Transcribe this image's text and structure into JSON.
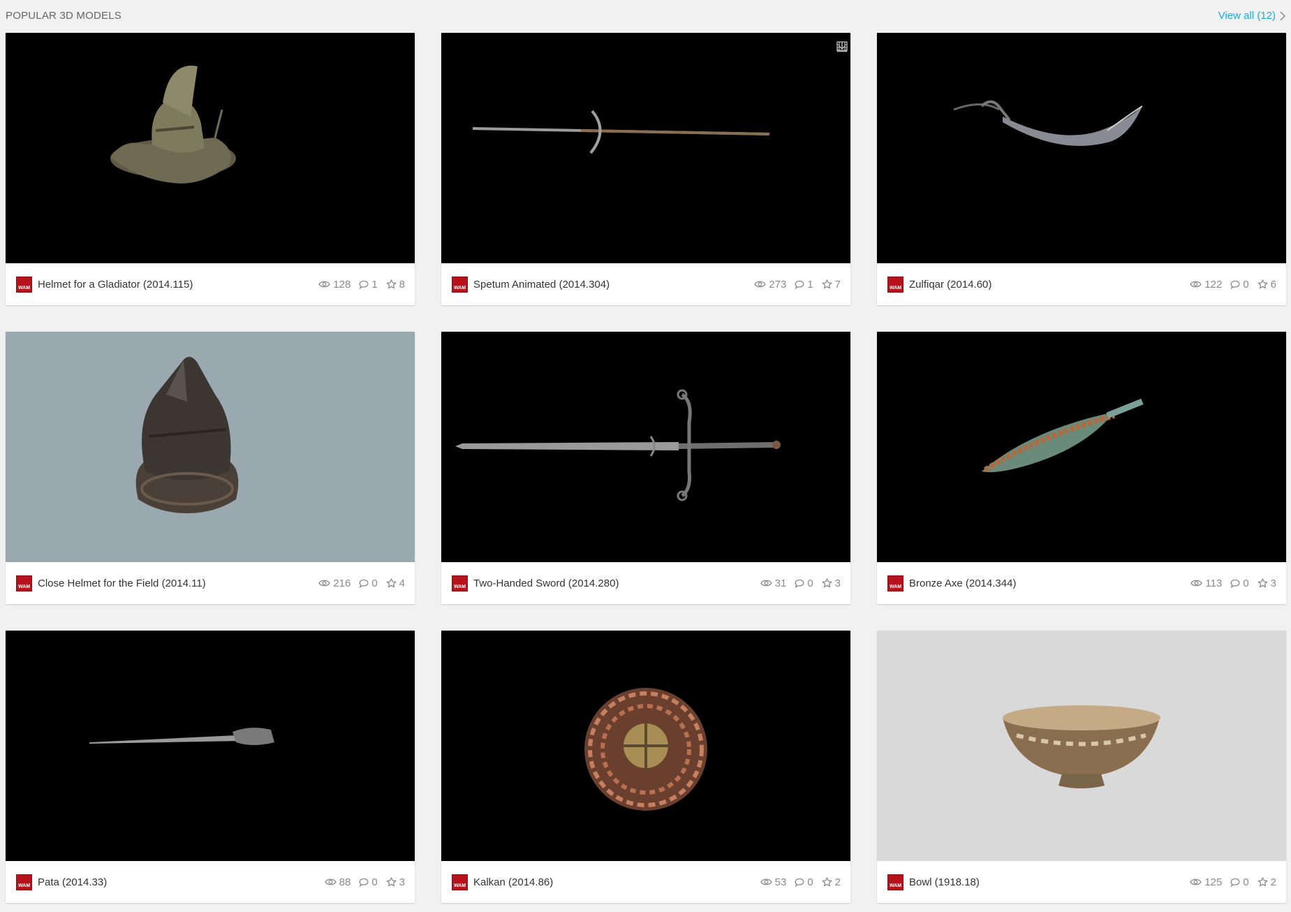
{
  "section": {
    "title": "POPULAR 3D MODELS",
    "view_all": "View all (12)"
  },
  "owner_badge": "WAM",
  "cards": [
    {
      "title": "Helmet for a Gladiator (2014.115)",
      "views": "128",
      "comments": "1",
      "likes": "8",
      "background": "#000000",
      "model_icon": "gladiator-helmet"
    },
    {
      "title": "Spetum Animated (2014.304)",
      "views": "273",
      "comments": "1",
      "likes": "7",
      "background": "#000000",
      "model_icon": "spetum-polearm",
      "has_animation_icon": true,
      "has_download_icon": true
    },
    {
      "title": "Zulfiqar (2014.60)",
      "views": "122",
      "comments": "0",
      "likes": "6",
      "background": "#000000",
      "model_icon": "zulfiqar-sword"
    },
    {
      "title": "Close Helmet for the Field (2014.11)",
      "views": "216",
      "comments": "0",
      "likes": "4",
      "background": "#9aa8b0",
      "model_icon": "close-helmet"
    },
    {
      "title": "Two-Handed Sword (2014.280)",
      "views": "31",
      "comments": "0",
      "likes": "3",
      "background": "#000000",
      "model_icon": "two-handed-sword"
    },
    {
      "title": "Bronze Axe (2014.344)",
      "views": "113",
      "comments": "0",
      "likes": "3",
      "background": "#000000",
      "model_icon": "bronze-axe"
    },
    {
      "title": "Pata (2014.33)",
      "views": "88",
      "comments": "0",
      "likes": "3",
      "background": "#000000",
      "model_icon": "pata-sword"
    },
    {
      "title": "Kalkan (2014.86)",
      "views": "53",
      "comments": "0",
      "likes": "2",
      "background": "#000000",
      "model_icon": "kalkan-shield"
    },
    {
      "title": "Bowl (1918.18)",
      "views": "125",
      "comments": "0",
      "likes": "2",
      "background": "#d9d9d9",
      "model_icon": "bowl"
    }
  ]
}
